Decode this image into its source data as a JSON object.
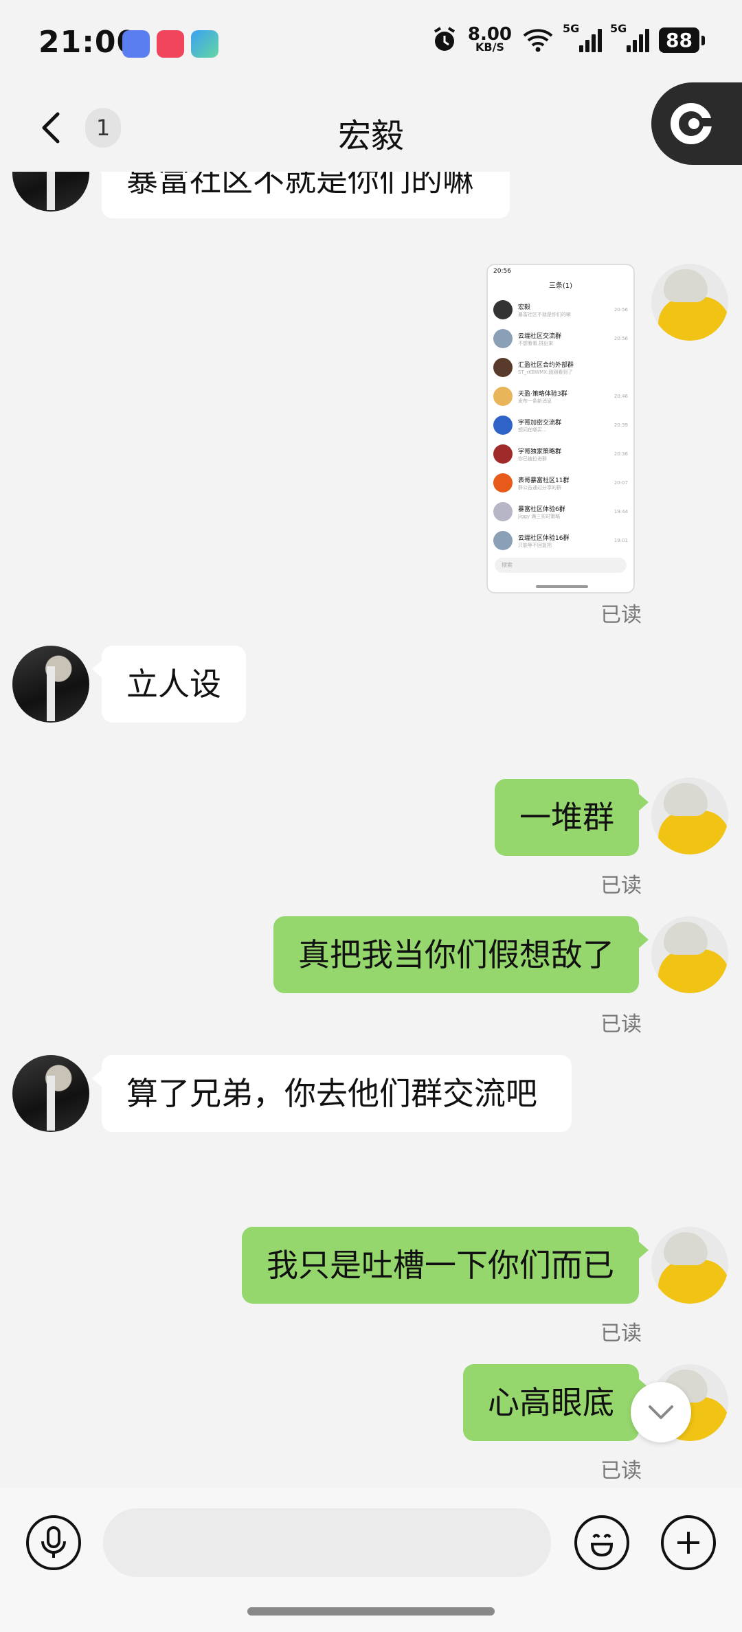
{
  "status_bar": {
    "time": "21:00",
    "net_speed": "8.00",
    "net_unit": "KB/S",
    "network_1": "5G",
    "network_2": "5G",
    "battery": "88"
  },
  "header": {
    "unread_count": "1",
    "title": "宏毅",
    "back_icon": "chevron-left-icon",
    "corner_icon": "capture-icon"
  },
  "messages": [
    {
      "side": "in",
      "type": "text",
      "text": "暴富社区不就是你们的嘛"
    },
    {
      "side": "out",
      "type": "image",
      "read": "已读"
    },
    {
      "side": "in",
      "type": "text",
      "text": "立人设"
    },
    {
      "side": "out",
      "type": "text",
      "text": "一堆群",
      "read": "已读"
    },
    {
      "side": "out",
      "type": "text",
      "text": "真把我当你们假想敌了",
      "read": "已读"
    },
    {
      "side": "in",
      "type": "text",
      "text": "算了兄弟，你去他们群交流吧"
    },
    {
      "side": "out",
      "type": "text",
      "text": "我只是吐槽一下你们而已",
      "read": "已读"
    },
    {
      "side": "out",
      "type": "text",
      "text": "心高眼底",
      "read": "已读"
    }
  ],
  "shared_screenshot": {
    "status": "20:56",
    "title": "三条(1)",
    "search_placeholder": "搜索",
    "chats": [
      {
        "name": "宏毅",
        "preview": "暴富社区不就是你们的嘛",
        "time": "20:56"
      },
      {
        "name": "云端社区交流群",
        "preview": "不想看看.挑出来",
        "time": "20:56"
      },
      {
        "name": "汇盈社区合约外部群",
        "preview": "ST_rKBWMX:刚刚看到了",
        "time": ""
      },
      {
        "name": "天盈·策略体验3群",
        "preview": "发布一条新消息",
        "time": "20:46"
      },
      {
        "name": "宇哥加密交流群",
        "preview": "想问在哪买...",
        "time": "20:39"
      },
      {
        "name": "宇哥独家策略群",
        "preview": "你已被拉进群",
        "time": "20:36"
      },
      {
        "name": "表哥暴富社区11群",
        "preview": "群公告通过分享的群",
        "time": "20:07"
      },
      {
        "name": "暴富社区体验6群",
        "preview": "Jiggy 满三实时策略",
        "time": "19:44"
      },
      {
        "name": "云端社区体验16群",
        "preview": "只能等不回复把",
        "time": "19:01"
      }
    ]
  },
  "input_bar": {
    "voice_icon": "microphone-icon",
    "emoji_icon": "emoji-icon",
    "plus_icon": "plus-icon"
  }
}
